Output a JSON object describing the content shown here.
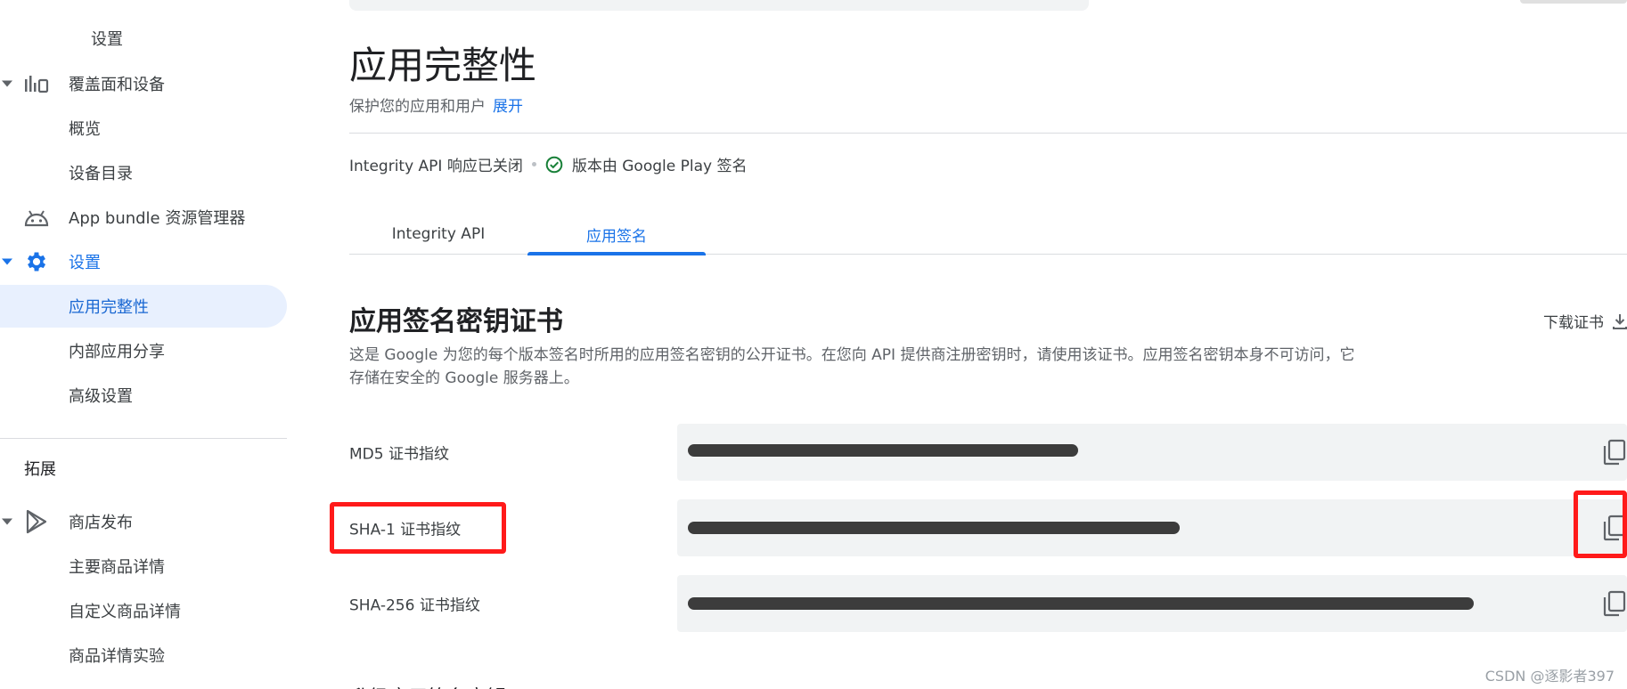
{
  "sidebar": {
    "items": [
      {
        "label": "设置",
        "kind": "sub"
      },
      {
        "label": "覆盖面和设备",
        "kind": "group",
        "icon": "bar-chart-devices-icon"
      },
      {
        "label": "概览",
        "kind": "sub"
      },
      {
        "label": "设备目录",
        "kind": "sub"
      },
      {
        "label": "App bundle 资源管理器",
        "kind": "top",
        "icon": "android-icon"
      },
      {
        "label": "设置",
        "kind": "group",
        "icon": "gear-icon"
      },
      {
        "label": "应用完整性",
        "kind": "sub",
        "active": true
      },
      {
        "label": "内部应用分享",
        "kind": "sub"
      },
      {
        "label": "高级设置",
        "kind": "sub"
      }
    ],
    "section_extend": "拓展",
    "items2": [
      {
        "label": "商店发布",
        "kind": "group",
        "icon": "play-store-icon"
      },
      {
        "label": "主要商品详情",
        "kind": "sub"
      },
      {
        "label": "自定义商品详情",
        "kind": "sub"
      },
      {
        "label": "商品详情实验",
        "kind": "sub"
      }
    ]
  },
  "header": {
    "title": "应用完整性",
    "subtitle": "保护您的应用和用户",
    "expand_link": "展开"
  },
  "status": {
    "integrity": "Integrity API 响应已关闭",
    "signing": "版本由 Google Play 签名"
  },
  "tabs": [
    {
      "label": "Integrity API",
      "selected": false
    },
    {
      "label": "应用签名",
      "selected": true
    }
  ],
  "cert": {
    "title": "应用签名密钥证书",
    "download": "下载证书",
    "description": "这是 Google 为您的每个版本签名时所用的应用签名密钥的公开证书。在您向 API 提供商注册密钥时，请使用该证书。应用签名密钥本身不可访问，它存储在安全的 Google 服务器上。",
    "rows": [
      {
        "label": "MD5 证书指纹"
      },
      {
        "label": "SHA-1 证书指纹"
      },
      {
        "label": "SHA-256 证书指纹"
      }
    ]
  },
  "next_section": "升级应用签名密钥",
  "watermark": "CSDN @逐影者397",
  "colors": {
    "accent": "#1a73e8",
    "active_bg": "#e8f0fe",
    "highlight": "#ff1a1a",
    "success": "#188038"
  }
}
